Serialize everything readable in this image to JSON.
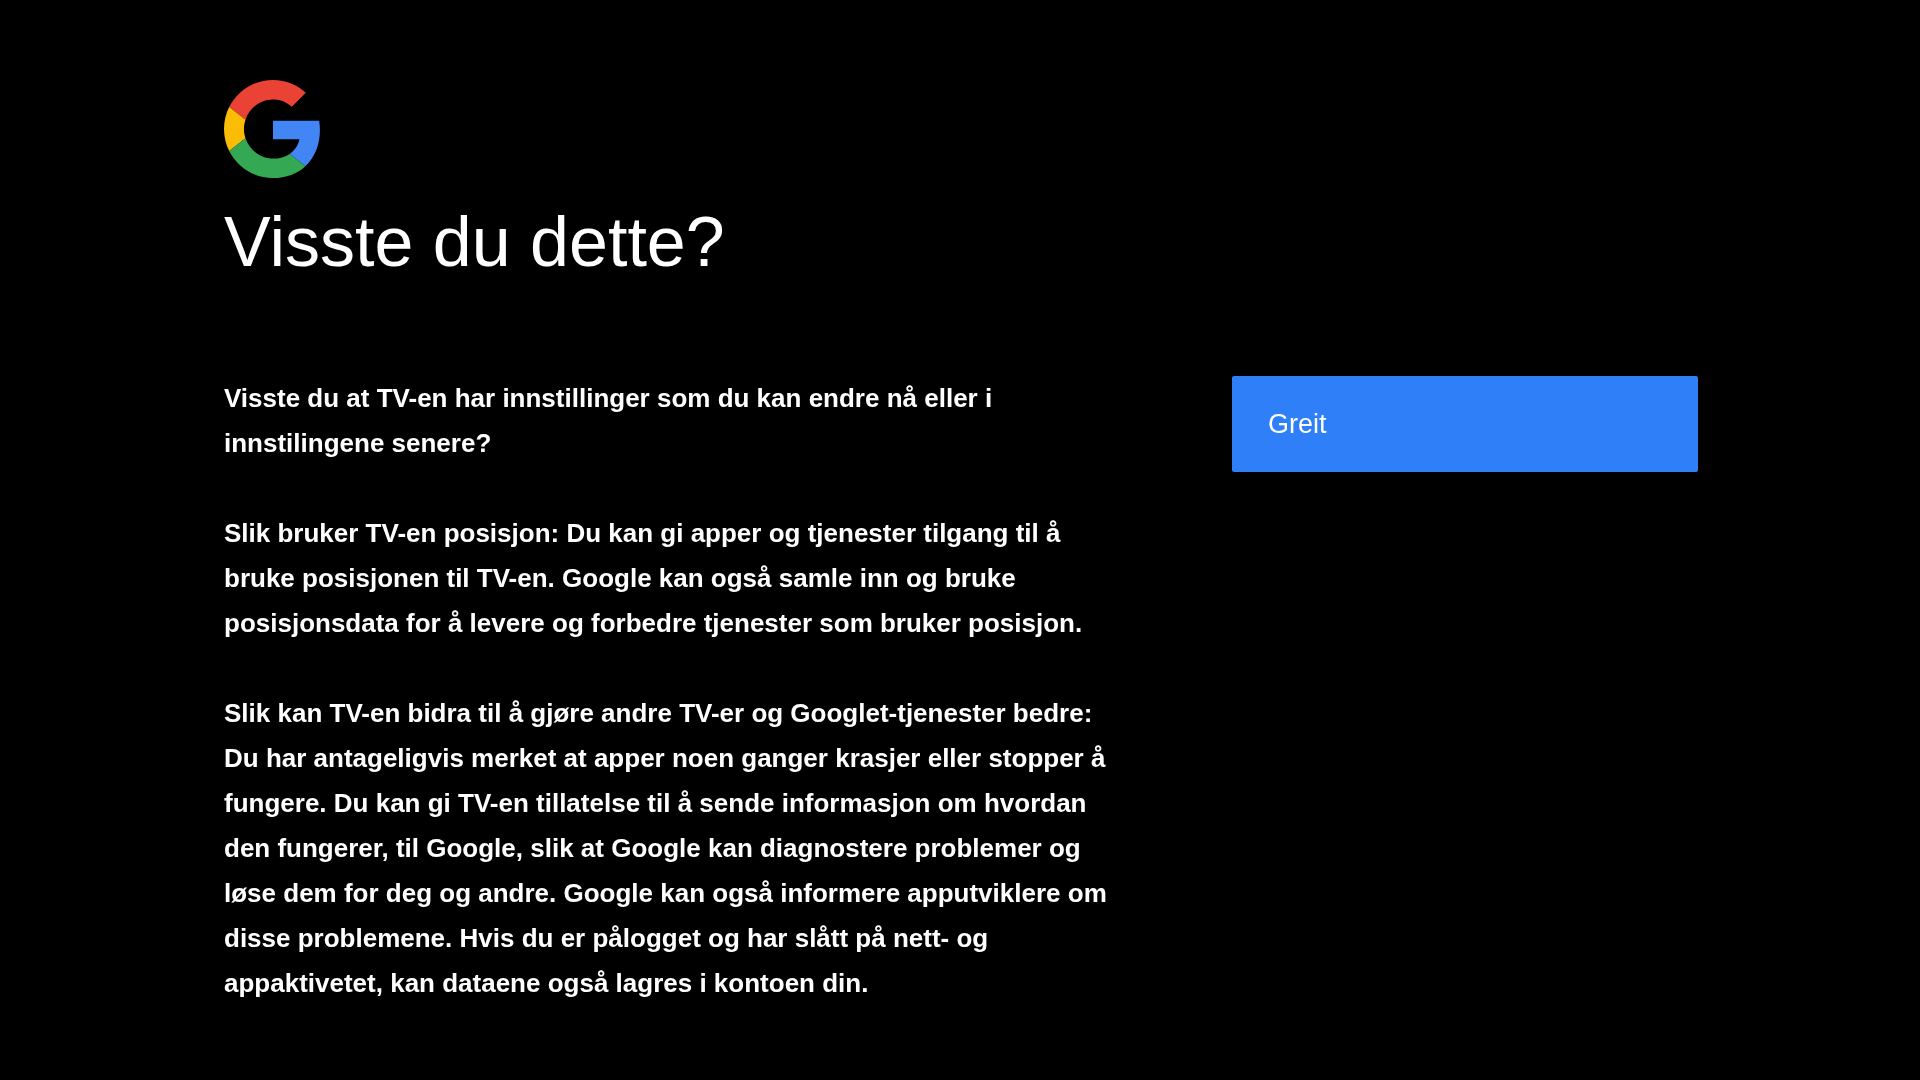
{
  "title": "Visste du dette?",
  "paragraphs": [
    "Visste du at TV-en har innstillinger som du kan endre nå eller i innstilingene senere?",
    "Slik bruker TV-en posisjon: Du kan gi apper og tjenester tilgang til å bruke posisjonen til TV-en. Google kan også samle inn og bruke posisjonsdata for å levere og forbedre tjenester som bruker posisjon.",
    "Slik kan TV-en bidra til å gjøre andre TV-er og Googlet-tjenester bedre: Du har antageligvis merket at apper noen ganger krasjer eller stopper å fungere. Du kan gi TV-en tillatelse til å sende informasjon om hvordan den fungerer, til Google, slik at Google kan diagnostere problemer og løse dem for deg og andre. Google kan også informere apputviklere om disse problemene. Hvis du er pålogget og har slått på nett- og appaktivetet, kan dataene også lagres i kontoen din."
  ],
  "button": {
    "label": "Greit"
  }
}
